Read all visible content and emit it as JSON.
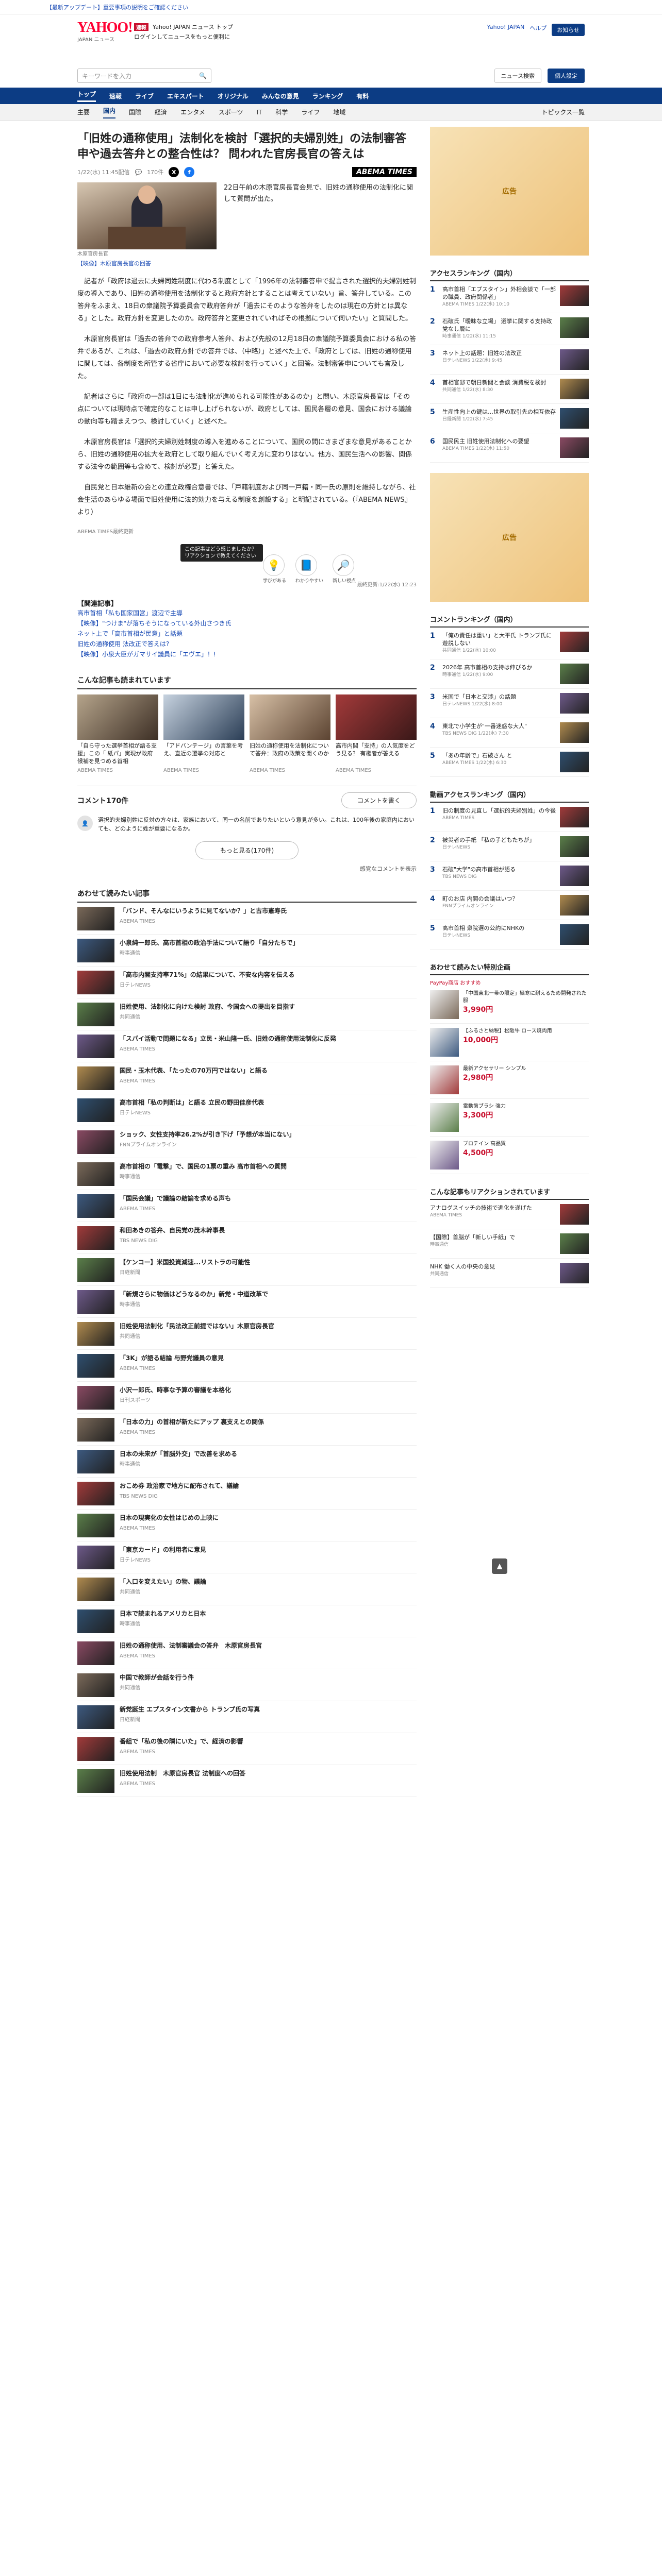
{
  "topbar": {
    "notice": "【最新アップデート】重要事項の説明をご確認ください"
  },
  "header": {
    "logo_text": "YAHOO!",
    "logo_sub": "JAPAN ニュース",
    "line1_tag": "速報",
    "line1": "Yahoo! JAPAN ニュース トップ",
    "line2": "ログインしてニュースをもっと便利に",
    "links": [
      "Yahoo! JAPAN",
      "ヘルプ"
    ],
    "notice_btn": "お知らせ"
  },
  "search": {
    "placeholder": "キーワードを入力",
    "btn_left": "ニュース検索",
    "btn_right": "個人設定"
  },
  "gnav": [
    "トップ",
    "速報",
    "ライブ",
    "エキスパート",
    "オリジナル",
    "みんなの意見",
    "ランキング",
    "有料"
  ],
  "cnav": [
    "主要",
    "国内",
    "国際",
    "経済",
    "エンタメ",
    "スポーツ",
    "IT",
    "科学",
    "ライフ",
    "地域"
  ],
  "cnav_right": "トピックス一覧",
  "article": {
    "title": "「旧姓の通称使用」法制化を検討「選択的夫婦別姓」の法制審答申や過去答弁との整合性は？ 問われた官房長官の答えは",
    "date": "1/22(水) 11:45配信",
    "comments_count": "170件",
    "brand": "ABEMA TIMES",
    "lead": "22日午前の木原官房長官会見で、旧姓の通称使用の法制化に関して質問が出た。",
    "caption": "【映像】木原官房長官の回答",
    "photo_caption": "木原官房長官",
    "paragraphs": [
      "記者が「政府は過去に夫婦同姓制度に代わる制度として「1996年の法制審答申で提言された選択的夫婦別姓制度の導入であり、旧姓の通称使用を法制化すると政府方針とすることは考えていない」旨、答弁している。この答弁をふまえ、18日の衆議院予算委員会で政府答弁が「過去にそのような答弁をしたのは現在の方針とは異なる」とした。政府方針を変更したのか。政府答弁と変更されていればその根拠について伺いたい」と質問した。",
      "木原官房長官は「過去の答弁での政府参考人答弁、および先般の12月18日の衆議院予算委員会における私の答弁であるが、これは、「過去の政府方針での答弁では、（中略）」と述べた上で、「政府としては、旧姓の通称使用に関しては、各制度を所管する省庁において必要な検討を行っていく」と回答。法制審答申についても言及した。",
      "記者はさらに「政府の一部は1日にも法制化が進められる可能性があるのか」と問い、木原官房長官は「その点については現時点で確定的なことは申し上げられないが、政府としては、国民各層の意見、国会における議論の動向等も踏まえつつ、検討していく」と述べた。",
      "木原官房長官は「選択的夫婦別姓制度の導入を進めることについて、国民の間にさまざまな意見があることから、旧姓の通称使用の拡大を政府として取り組んでいく考え方に変わりはない。他方、国民生活への影響、関係する法令の範囲等も含めて、検討が必要」と答えた。",
      "自民党と日本維新の会との連立政権合意書では、「戸籍制度および同一戸籍・同一氏の原則を維持しながら、社会生活のあらゆる場面で旧姓使用に法的効力を与える制度を創設する」と明記されている。（『ABEMA NEWS』より）"
    ],
    "source_label": "ABEMA TIMES最終更新",
    "updated": "最終更新:1/22(水) 12:23",
    "tooltip": "この記事はどう感じましたか？リアクションで教えてください",
    "reactions": [
      {
        "label": "学びがある",
        "icon": "💡"
      },
      {
        "label": "わかりやすい",
        "icon": "📘"
      },
      {
        "label": "新しい視点",
        "icon": "🔎"
      }
    ],
    "related_label": "【関連記事】",
    "related": [
      "高市首相「私も国家国営」渡辺で主導",
      "【映像】\"つけま\"が落ちそうになっている外山さつき氏",
      "ネット上で「高市首相が民意」と話題",
      "旧姓の通称使用 法改正で答えは?",
      "【映像】小泉大臣がガマサイ議員に「エヴエ」！!"
    ]
  },
  "recommend": {
    "title": "こんな記事も読まれています",
    "cards": [
      {
        "title": "「自ら守った選挙首相が語る支援」この「 紙パ」実現が政府候補を見つめる首相",
        "src": "ABEMA TIMES"
      },
      {
        "title": "「アドバンテージ」の言葉を考え、直近の選挙の対応と",
        "src": "ABEMA TIMES"
      },
      {
        "title": "旧姓の通称使用を法制化について答弁：政府の政策を聞くのか",
        "src": "ABEMA TIMES"
      },
      {
        "title": "高市内閣「支持」の人気度をどう見る？ 有権者が答える",
        "src": "ABEMA TIMES"
      }
    ]
  },
  "comments": {
    "label": "コメント170件",
    "write_btn": "コメントを書く",
    "sample": "選択的夫婦別姓に反対の方々は、家族において、同一の名前でありたいという意見が多い。これは、100年後の家庭内においても、どのように姓が重要になるか。",
    "more_btn": "もっと見る(170件)",
    "notice": "感覚なコメントを表示"
  },
  "feed_title": "あわせて読みたい記事",
  "feed": [
    {
      "title": "「バンド、そんなにいうように見てないか？」と古市憲寿氏",
      "src": "ABEMA TIMES"
    },
    {
      "title": "小泉純一郎氏、高市首相の政治手法について語り「自分たちで」",
      "src": "時事通信"
    },
    {
      "title": "「高市内閣支持率71%」の結果について、不安な内容を伝える",
      "src": "日テレNEWS"
    },
    {
      "title": "旧姓使用、法制化に向けた検討 政府、今国会への提出を目指す",
      "src": "共同通信"
    },
    {
      "title": "「スパイ活動で問題になる」立民・米山隆一氏、旧姓の通称使用法制化に反発",
      "src": "ABEMA TIMES"
    },
    {
      "title": "国民・玉木代表、「たったの70万円ではない」と語る",
      "src": "ABEMA TIMES"
    },
    {
      "title": "高市首相「私の判断は」と語る 立民の野田佳彦代表",
      "src": "日テレNEWS"
    },
    {
      "title": "ショック、女性支持率26.2%が引き下げ「予想が本当にない」",
      "src": "FNNプライムオンライン"
    },
    {
      "title": "高市首相の「電撃」で、国民の1票の重み 高市首相への質問",
      "src": "時事通信"
    },
    {
      "title": "「国民会議」で議論の結論を求める声も",
      "src": "ABEMA TIMES"
    },
    {
      "title": "和田あきの答弁、自民党の茂木幹事長",
      "src": "TBS NEWS DIG"
    },
    {
      "title": "【ケンコー】米国投資減速...リストラの可能性",
      "src": "日経新聞"
    },
    {
      "title": "「新規さらに物価はどうなるのか」新党・中道改革で",
      "src": "時事通信"
    },
    {
      "title": "旧姓使用法制化「民法改正前提ではない」木原官房長官",
      "src": "共同通信"
    },
    {
      "title": "「3K」が語る結論 与野党議員の意見",
      "src": "ABEMA TIMES"
    },
    {
      "title": "小沢一郎氏、時事な予算の審議を本格化",
      "src": "日刊スポーツ"
    },
    {
      "title": "「日本の力」の首相が新たにアップ 裏支えとの関係",
      "src": "ABEMA TIMES"
    },
    {
      "title": "日本の未来が「首脳外交」で改善を求める",
      "src": "時事通信"
    },
    {
      "title": "おこめ券 政治家で地方に配布されて、議論",
      "src": "TBS NEWS DIG"
    },
    {
      "title": "日本の現実化の女性はじめの上映に",
      "src": "ABEMA TIMES"
    },
    {
      "title": "「東京カード」の利用者に意見",
      "src": "日テレNEWS"
    },
    {
      "title": "「入口を変えたい」の物、議論",
      "src": "共同通信"
    },
    {
      "title": "日本で読まれるアメリカと日本",
      "src": "時事通信"
    },
    {
      "title": "旧姓の通称使用、法制審議会の答弁　木原官房長官",
      "src": "ABEMA TIMES"
    },
    {
      "title": "中国で教師が会話を行う件",
      "src": "共同通信"
    },
    {
      "title": "新党誕生 エプスタイン文書から トランプ氏の写真",
      "src": "日経新聞"
    },
    {
      "title": "番組で「私の後の隣にいた」で、経済の影響",
      "src": "ABEMA TIMES"
    },
    {
      "title": "旧姓使用法制　木原官房長官 法制度への回答",
      "src": "ABEMA TIMES"
    }
  ],
  "side": {
    "ad_text": "広告",
    "access_title": "アクセスランキング（国内）",
    "access": [
      {
        "t": "高市首相「エプスタイン」外相会談で「一部の職員、政府関係者」",
        "s": "ABEMA TIMES 1/22(水) 10:10"
      },
      {
        "t": "石破氏「曖昧な立場」 選挙に関する支持政党なし層に",
        "s": "時事通信 1/22(水) 11:15"
      },
      {
        "t": "ネット上の話題：旧姓の法改正",
        "s": "日テレNEWS 1/22(水) 9:45"
      },
      {
        "t": "首相官邸で朝日新聞と会談 消費税を検討",
        "s": "共同通信 1/22(水) 8:30"
      },
      {
        "t": "生産性向上の鍵は…世界の取引先の相互依存",
        "s": "日経新聞 1/22(水) 7:45"
      },
      {
        "t": "国民民主 旧姓使用法制化への要望",
        "s": "ABEMA TIMES 1/22(水) 11:50"
      }
    ],
    "comment_title": "コメントランキング（国内）",
    "comment": [
      {
        "t": "「俺の責任は重い」と大平氏 トランプ氏に遊説しない",
        "s": "共同通信 1/22(水) 10:00"
      },
      {
        "t": "2026年 高市首相の支持は伸びるか",
        "s": "時事通信 1/22(水) 9:00"
      },
      {
        "t": "米国で「日本と交渉」の話題",
        "s": "日テレNEWS 1/22(水) 8:00"
      },
      {
        "t": "東北で小学生が\"一番迷惑な大人\"",
        "s": "TBS NEWS DIG 1/22(水) 7:30"
      },
      {
        "t": "「あの年齢で」石破さん と",
        "s": "ABEMA TIMES 1/22(水) 6:30"
      }
    ],
    "video_title": "動画アクセスランキング（国内）",
    "video": [
      {
        "t": "旧の制度の見直し「選択的夫婦別姓」の今後",
        "s": "ABEMA TIMES"
      },
      {
        "t": "被災者の手紙 「私の子どもたちが」",
        "s": "日テレNEWS"
      },
      {
        "t": "石破\"大学\"の高市首相が語る",
        "s": "TBS NEWS DIG"
      },
      {
        "t": "町のお店 内閣の会議はいつ？",
        "s": "FNNプライムオンライン"
      },
      {
        "t": "高市首相 衆院選の公約にNHKの",
        "s": "日テレNEWS"
      }
    ],
    "shop_title": "あわせて読みたい特別企画",
    "shop_tag": "PayPay商店 おすすめ",
    "shop": [
      {
        "t": "「中国東北一帯の限定」極寒に耐えるため開発された服",
        "p": "3,990円"
      },
      {
        "t": "【ふるさと納税】松阪牛 ロース焼肉用",
        "p": "10,000円"
      },
      {
        "t": "最新アクセサリー シンプル",
        "p": "2,980円"
      },
      {
        "t": "電動歯ブラシ 強力",
        "p": "3,300円"
      },
      {
        "t": "プロテイン 高品質",
        "p": "4,500円"
      }
    ],
    "reco_title": "こんな記事もリアクションされています",
    "reco": [
      {
        "t": "アナログスイッチの技術で進化を遂げた",
        "s": "ABEMA TIMES"
      },
      {
        "t": "【国際】首脳が「新しい手紙」で",
        "s": "時事通信"
      },
      {
        "t": "NHK 働く人の中央の意見",
        "s": "共同通信"
      }
    ]
  },
  "top_btn": "▲"
}
